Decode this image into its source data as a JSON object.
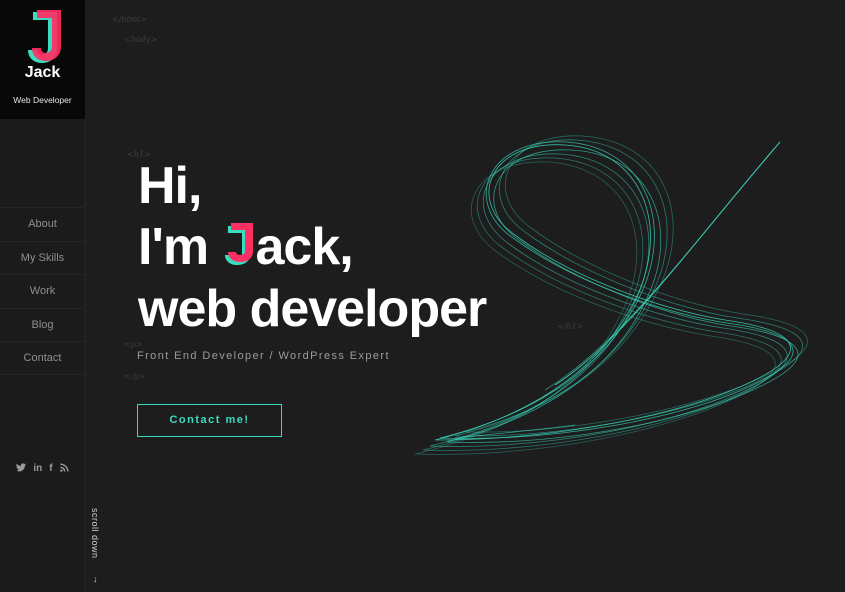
{
  "brand": {
    "logo_letter": "J",
    "name": "Jack",
    "role": "Web Developer",
    "colors": {
      "j_pink": "#ff2e63",
      "j_teal": "#3adcc0",
      "accent": "#3adcc0"
    }
  },
  "nav": {
    "items": [
      {
        "label": "About"
      },
      {
        "label": "My Skills"
      },
      {
        "label": "Work"
      },
      {
        "label": "Blog"
      },
      {
        "label": "Contact"
      }
    ]
  },
  "social": {
    "icons": [
      {
        "name": "twitter-icon",
        "glyph": "🐦"
      },
      {
        "name": "linkedin-icon",
        "glyph": "in"
      },
      {
        "name": "facebook-icon",
        "glyph": "f"
      },
      {
        "name": "rss-icon",
        "glyph": "☍"
      }
    ]
  },
  "scroll": {
    "label": "scroll down",
    "arrow": "↓"
  },
  "code_tags": {
    "html_close": "</html>",
    "body_open": "<body>",
    "h1_open": "<h1>",
    "h1_close": "</h1>",
    "p_open": "<p>",
    "p_close": "</p>"
  },
  "hero": {
    "line1": "Hi,",
    "line2_pre": "I'm ",
    "line2_letter": "J",
    "line2_post": "ack,",
    "line3": "web developer",
    "subtitle": "Front End Developer / WordPress Expert",
    "cta_label": "Contact me!"
  }
}
